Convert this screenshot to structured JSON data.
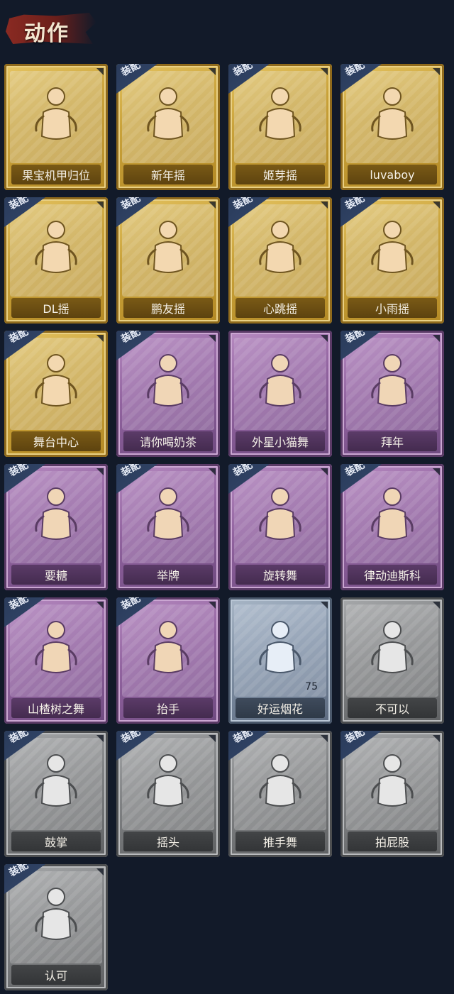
{
  "header": {
    "title": "动作"
  },
  "emotes": [
    {
      "label": "果宝机甲归位",
      "tier": "gold",
      "equipped": false
    },
    {
      "label": "新年摇",
      "tier": "gold",
      "equipped": true
    },
    {
      "label": "姬芽摇",
      "tier": "gold",
      "equipped": true
    },
    {
      "label": "luvaboy",
      "tier": "gold",
      "equipped": true
    },
    {
      "label": "DL摇",
      "tier": "gold",
      "equipped": true
    },
    {
      "label": "鹏友摇",
      "tier": "gold",
      "equipped": true
    },
    {
      "label": "心跳摇",
      "tier": "gold",
      "equipped": true
    },
    {
      "label": "小雨摇",
      "tier": "gold",
      "equipped": true
    },
    {
      "label": "舞台中心",
      "tier": "gold",
      "equipped": true
    },
    {
      "label": "请你喝奶茶",
      "tier": "purple",
      "equipped": true
    },
    {
      "label": "外星小猫舞",
      "tier": "purple",
      "equipped": false
    },
    {
      "label": "拜年",
      "tier": "purple",
      "equipped": true
    },
    {
      "label": "要糖",
      "tier": "purple",
      "equipped": true
    },
    {
      "label": "举牌",
      "tier": "purple",
      "equipped": true
    },
    {
      "label": "旋转舞",
      "tier": "purple",
      "equipped": true
    },
    {
      "label": "律动迪斯科",
      "tier": "purple",
      "equipped": true
    },
    {
      "label": "山楂树之舞",
      "tier": "purple",
      "equipped": true
    },
    {
      "label": "抬手",
      "tier": "purple",
      "equipped": true
    },
    {
      "label": "好运烟花",
      "tier": "blue",
      "equipped": false,
      "count": "75"
    },
    {
      "label": "不可以",
      "tier": "gray",
      "equipped": false
    },
    {
      "label": "鼓掌",
      "tier": "gray",
      "equipped": true
    },
    {
      "label": "摇头",
      "tier": "gray",
      "equipped": true
    },
    {
      "label": "推手舞",
      "tier": "gray",
      "equipped": true
    },
    {
      "label": "拍屁股",
      "tier": "gray",
      "equipped": true
    },
    {
      "label": "认可",
      "tier": "gray",
      "equipped": true
    }
  ],
  "equip_badge_text": "装配",
  "colors": {
    "background": "#121a29",
    "gold": "#c9a23a",
    "purple": "#91639f",
    "blue": "#7f8fa3",
    "gray": "#7f8183",
    "header_brush": "#8a2a22"
  }
}
